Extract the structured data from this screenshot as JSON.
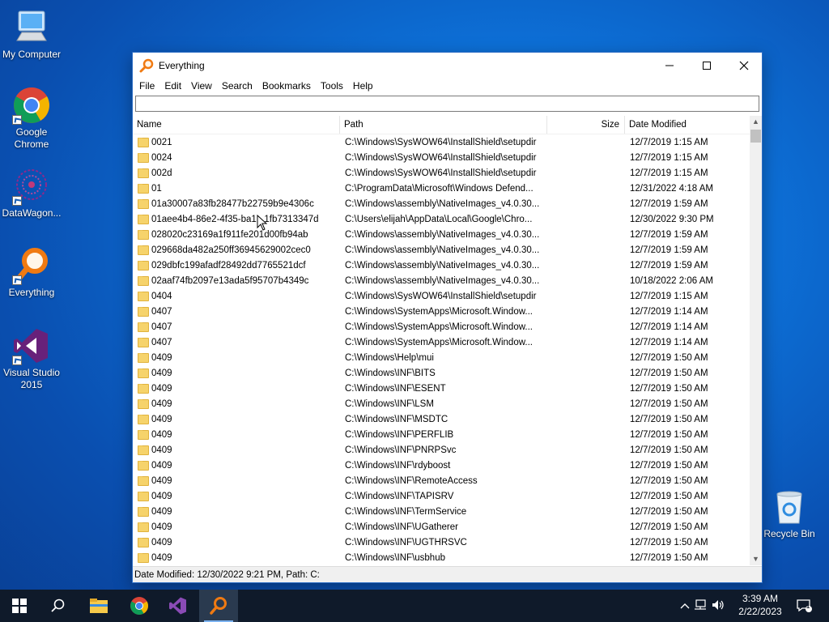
{
  "desktop": {
    "icons": [
      {
        "label": "My Computer",
        "icon": "monitor-icon"
      },
      {
        "label": "Google Chrome",
        "icon": "chrome-icon"
      },
      {
        "label": "DataWagon...",
        "icon": "datawagon-icon"
      },
      {
        "label": "Everything",
        "icon": "everything-magnifier-icon"
      },
      {
        "label": "Visual Studio 2015",
        "icon": "visual-studio-icon"
      },
      {
        "label": "Recycle Bin",
        "icon": "recycle-bin-icon"
      }
    ]
  },
  "window": {
    "title": "Everything",
    "menu": [
      "File",
      "Edit",
      "View",
      "Search",
      "Bookmarks",
      "Tools",
      "Help"
    ],
    "search_value": "",
    "columns": {
      "name": "Name",
      "path": "Path",
      "size": "Size",
      "date": "Date Modified"
    },
    "rows": [
      {
        "name": "0021",
        "path": "C:\\Windows\\SysWOW64\\InstallShield\\setupdir",
        "size": "",
        "date": "12/7/2019 1:15 AM"
      },
      {
        "name": "0024",
        "path": "C:\\Windows\\SysWOW64\\InstallShield\\setupdir",
        "size": "",
        "date": "12/7/2019 1:15 AM"
      },
      {
        "name": "002d",
        "path": "C:\\Windows\\SysWOW64\\InstallShield\\setupdir",
        "size": "",
        "date": "12/7/2019 1:15 AM"
      },
      {
        "name": "01",
        "path": "C:\\ProgramData\\Microsoft\\Windows Defend...",
        "size": "",
        "date": "12/31/2022 4:18 AM"
      },
      {
        "name": "01a30007a83fb28477b22759b9e4306c",
        "path": "C:\\Windows\\assembly\\NativeImages_v4.0.30...",
        "size": "",
        "date": "12/7/2019 1:59 AM"
      },
      {
        "name": "01aee4b4-86e2-4f35-ba1...1fb7313347d",
        "path": "C:\\Users\\elijah\\AppData\\Local\\Google\\Chro...",
        "size": "",
        "date": "12/30/2022 9:30 PM"
      },
      {
        "name": "028020c23169a1f911fe201d00fb94ab",
        "path": "C:\\Windows\\assembly\\NativeImages_v4.0.30...",
        "size": "",
        "date": "12/7/2019 1:59 AM"
      },
      {
        "name": "029668da482a250ff36945629002cec0",
        "path": "C:\\Windows\\assembly\\NativeImages_v4.0.30...",
        "size": "",
        "date": "12/7/2019 1:59 AM"
      },
      {
        "name": "029dbfc199afadf28492dd7765521dcf",
        "path": "C:\\Windows\\assembly\\NativeImages_v4.0.30...",
        "size": "",
        "date": "12/7/2019 1:59 AM"
      },
      {
        "name": "02aaf74fb2097e13ada5f95707b4349c",
        "path": "C:\\Windows\\assembly\\NativeImages_v4.0.30...",
        "size": "",
        "date": "10/18/2022 2:06 AM"
      },
      {
        "name": "0404",
        "path": "C:\\Windows\\SysWOW64\\InstallShield\\setupdir",
        "size": "",
        "date": "12/7/2019 1:15 AM"
      },
      {
        "name": "0407",
        "path": "C:\\Windows\\SystemApps\\Microsoft.Window...",
        "size": "",
        "date": "12/7/2019 1:14 AM"
      },
      {
        "name": "0407",
        "path": "C:\\Windows\\SystemApps\\Microsoft.Window...",
        "size": "",
        "date": "12/7/2019 1:14 AM"
      },
      {
        "name": "0407",
        "path": "C:\\Windows\\SystemApps\\Microsoft.Window...",
        "size": "",
        "date": "12/7/2019 1:14 AM"
      },
      {
        "name": "0409",
        "path": "C:\\Windows\\Help\\mui",
        "size": "",
        "date": "12/7/2019 1:50 AM"
      },
      {
        "name": "0409",
        "path": "C:\\Windows\\INF\\BITS",
        "size": "",
        "date": "12/7/2019 1:50 AM"
      },
      {
        "name": "0409",
        "path": "C:\\Windows\\INF\\ESENT",
        "size": "",
        "date": "12/7/2019 1:50 AM"
      },
      {
        "name": "0409",
        "path": "C:\\Windows\\INF\\LSM",
        "size": "",
        "date": "12/7/2019 1:50 AM"
      },
      {
        "name": "0409",
        "path": "C:\\Windows\\INF\\MSDTC",
        "size": "",
        "date": "12/7/2019 1:50 AM"
      },
      {
        "name": "0409",
        "path": "C:\\Windows\\INF\\PERFLIB",
        "size": "",
        "date": "12/7/2019 1:50 AM"
      },
      {
        "name": "0409",
        "path": "C:\\Windows\\INF\\PNRPSvc",
        "size": "",
        "date": "12/7/2019 1:50 AM"
      },
      {
        "name": "0409",
        "path": "C:\\Windows\\INF\\rdyboost",
        "size": "",
        "date": "12/7/2019 1:50 AM"
      },
      {
        "name": "0409",
        "path": "C:\\Windows\\INF\\RemoteAccess",
        "size": "",
        "date": "12/7/2019 1:50 AM"
      },
      {
        "name": "0409",
        "path": "C:\\Windows\\INF\\TAPISRV",
        "size": "",
        "date": "12/7/2019 1:50 AM"
      },
      {
        "name": "0409",
        "path": "C:\\Windows\\INF\\TermService",
        "size": "",
        "date": "12/7/2019 1:50 AM"
      },
      {
        "name": "0409",
        "path": "C:\\Windows\\INF\\UGatherer",
        "size": "",
        "date": "12/7/2019 1:50 AM"
      },
      {
        "name": "0409",
        "path": "C:\\Windows\\INF\\UGTHRSVC",
        "size": "",
        "date": "12/7/2019 1:50 AM"
      },
      {
        "name": "0409",
        "path": "C:\\Windows\\INF\\usbhub",
        "size": "",
        "date": "12/7/2019 1:50 AM"
      }
    ],
    "status": "Date Modified: 12/30/2022 9:21 PM, Path: C:"
  },
  "taskbar": {
    "items": [
      "start-icon",
      "search-icon",
      "file-explorer-icon",
      "chrome-icon",
      "visual-studio-icon",
      "everything-magnifier-icon"
    ],
    "active": "everything-magnifier-icon",
    "time": "3:39 AM",
    "date": "2/22/2023",
    "notification_count": "1"
  },
  "colors": {
    "desktop_blue": "#0d6fd6",
    "window_border": "#2b6cc4",
    "taskbar": "#0f1a2a",
    "folder": "#f6d36b"
  }
}
